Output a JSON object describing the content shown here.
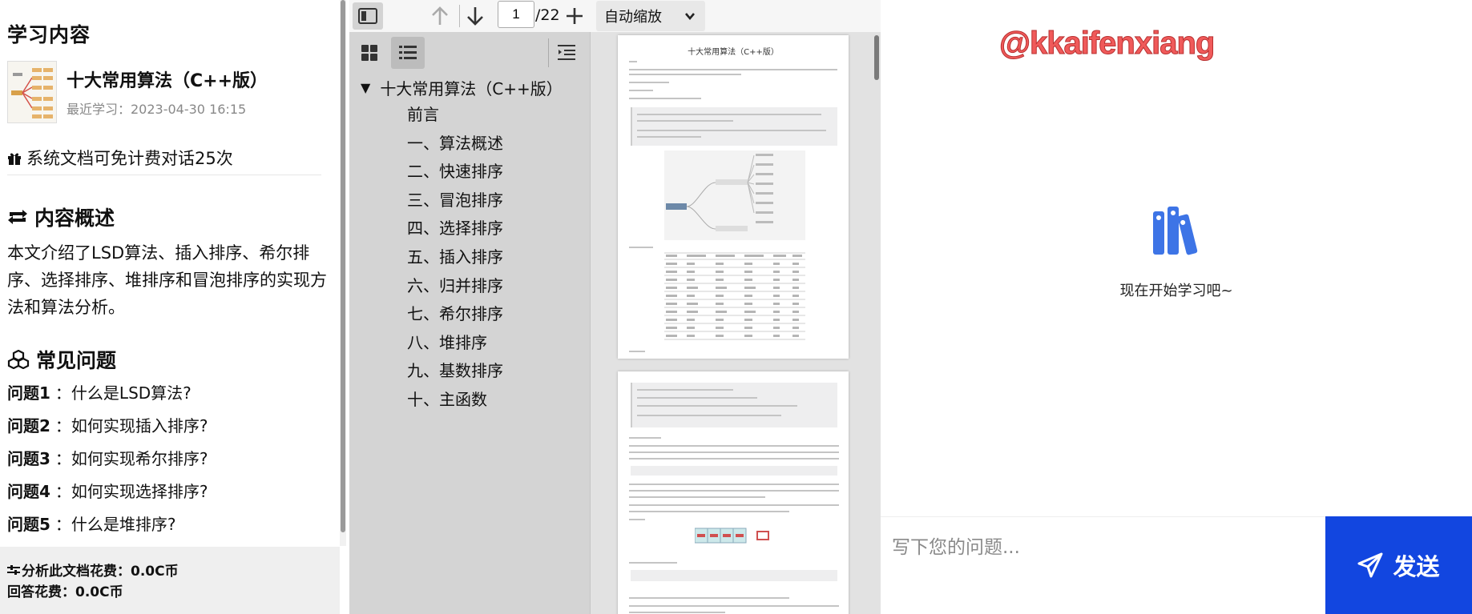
{
  "left_panel": {
    "section_title": "学习内容",
    "document": {
      "title": "十大常用算法（C++版）",
      "last_study": "最近学习：2023-04-30 16:15"
    },
    "free_tip": "系统文档可免计费对话25次",
    "overview": {
      "title": "内容概述",
      "text": "本文介绍了LSD算法、插入排序、希尔排序、选择排序、堆排序和冒泡排序的实现方法和算法分析。"
    },
    "faq": {
      "title": "常见问题",
      "items": [
        {
          "label": "问题1",
          "sep": "：",
          "question": "什么是LSD算法?"
        },
        {
          "label": "问题2",
          "sep": "：",
          "question": "如何实现插入排序?"
        },
        {
          "label": "问题3",
          "sep": "：",
          "question": "如何实现希尔排序?"
        },
        {
          "label": "问题4",
          "sep": "：",
          "question": "如何实现选择排序?"
        },
        {
          "label": "问题5",
          "sep": "：",
          "question": "什么是堆排序?"
        }
      ]
    },
    "cost": {
      "analyze": "分析此文档花费：0.0C币",
      "answer": "回答花费：0.0C币"
    }
  },
  "viewer": {
    "page_number": "1",
    "page_total": "/22",
    "zoom": "自动缩放",
    "outline_root": "十大常用算法（C++版）",
    "outline_items": [
      "前言",
      "一、算法概述",
      "二、快速排序",
      "三、冒泡排序",
      "四、选择排序",
      "五、插入排序",
      "六、归并排序",
      "七、希尔排序",
      "八、堆排序",
      "九、基数排序",
      "十、主函数"
    ],
    "page1_title": "十大常用算法（C++版）"
  },
  "chat": {
    "watermark": "@kkaifenxiang",
    "empty_text": "现在开始学习吧~",
    "input_placeholder": "写下您的问题...",
    "send_label": "发送"
  },
  "colors": {
    "send_button": "#1246e0",
    "empty_icon": "#3d74e6",
    "watermark": "#f05a5a"
  }
}
